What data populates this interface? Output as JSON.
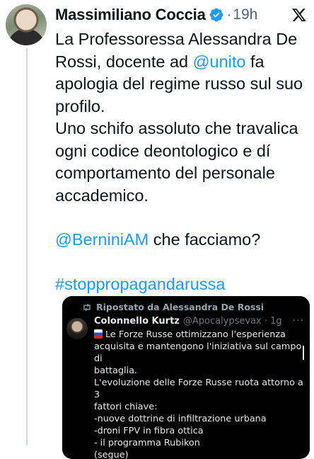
{
  "author": {
    "name": "Massimiliano Coccia",
    "time": "19h",
    "separator": "·"
  },
  "tweet": {
    "para1_a": "La Professoressa Alessandra De Rossi, docente ad ",
    "mention_unito": "@unito",
    "para1_b": " fa apologia del regime russo sul suo profilo.",
    "para2": "Uno schifo assoluto che travalica ogni codice deontologico e dí comportamento del personale accademico.",
    "mention_bernini": "@BerniniAM",
    "para3_rest": " che facciamo?",
    "hashtag": "#stoppropagandarussa"
  },
  "media": {
    "repost_label": "Ripostato da Alessandra De Rossi",
    "inner_author": "Colonnello Kurtz",
    "inner_handle": "@Apocalypsevax · 1g",
    "inner_menu": "···",
    "lines": [
      "Le Forze Russe ottimizzano l'esperienza",
      "acquisita e mantengono l'iniziativa sul campo di",
      "battaglia.",
      "L'evoluzione delle Forze Russe ruota attorno a 3",
      "fattori chiave:",
      "-nuove dottrine di infiltrazione urbana",
      "-droni FPV in fibra ottica",
      "- il programma  Rubikon",
      "(segue)"
    ]
  },
  "colors": {
    "link": "#1d9bf0",
    "verified": "#1d9bf0",
    "text": "#0f1419",
    "muted": "#536471"
  },
  "icons": [
    "verified-badge-icon",
    "x-logo-icon",
    "repost-icon",
    "russia-flag-icon"
  ]
}
